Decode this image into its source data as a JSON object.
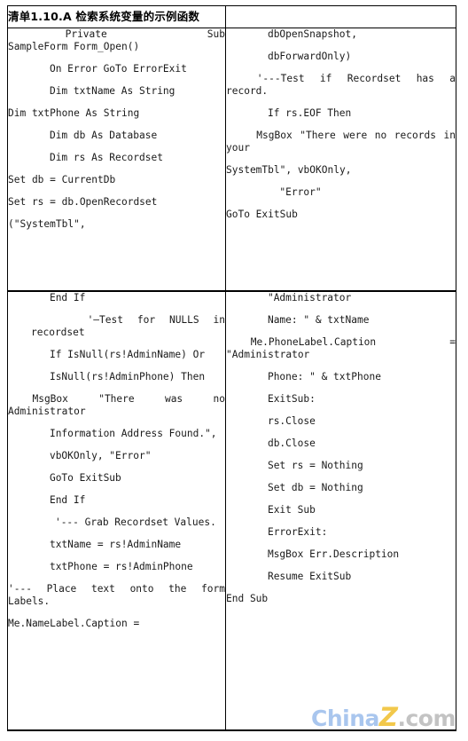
{
  "document": {
    "title": "清单1.10.A 检索系统变量的示例函数",
    "language": "Visual Basic for Applications"
  },
  "table": {
    "header": {
      "title_cell": "清单1.10.A 检索系统变量的示例函数",
      "blank_cell": ""
    },
    "columns": [
      {
        "name": "left-code-column"
      },
      {
        "name": "right-code-column"
      }
    ],
    "rows": [
      {
        "row_index": 1,
        "cells": {
          "left": [
            "    Private       Sub      SampleForm Form_Open()",
            "    On Error GoTo ErrorExit",
            "    Dim txtName As String",
            "Dim txtPhone As String",
            "    Dim db As Database",
            "    Dim rs As Recordset",
            "Set db = CurrentDb",
            "Set rs = db.OpenRecordset",
            "(\"SystemTbl\","
          ],
          "right": [
            "    dbOpenSnapshot,",
            "    dbForwardOnly)",
            "    '---Test  if  Recordset  has  a record.",
            "    If rs.EOF Then",
            "    MsgBox \"There were no records in your",
            "SystemTbl\", vbOKOnly,",
            "      \"Error\"",
            "GoTo ExitSub"
          ]
        }
      },
      {
        "row_index": 2,
        "cells": {
          "left": [
            "    End If",
            "    '—Test for NULLS in recordset",
            "    If IsNull(rs!AdminName) Or",
            "    IsNull(rs!AdminPhone) Then",
            "    MsgBox     \"There     was     no Administrator",
            "    Information Address Found.\",",
            "    vbOKOnly, \"Error\"",
            "    GoTo ExitSub",
            "    End If",
            "    '--- Grab Recordset Values.",
            "    txtName = rs!AdminName",
            "    txtPhone = rs!AdminPhone",
            "'---  Place  text  onto  the  form Labels.",
            "Me.NameLabel.Caption ="
          ],
          "right": [
            "    \"Administrator",
            "    Name: \" & txtName",
            "    Me.PhoneLabel.Caption            = \"Administrator",
            "    Phone: \" & txtPhone",
            "    ExitSub:",
            "    rs.Close",
            "    db.Close",
            "    Set rs = Nothing",
            "    Set db = Nothing",
            "    Exit Sub",
            "    ErrorExit:",
            "    MsgBox Err.Description",
            "    Resume ExitSub",
            "End Sub"
          ]
        }
      }
    ]
  },
  "watermark": {
    "part_china": "China",
    "part_z": "Z",
    "part_com": ".com",
    "color_china": "#a9c6ee",
    "color_z": "#f2c84b",
    "color_com": "#c3c3c3"
  },
  "colors": {
    "page_background": "#ffffff",
    "border": "#000000",
    "text": "#000000",
    "code_text": "#1a1a1a"
  }
}
